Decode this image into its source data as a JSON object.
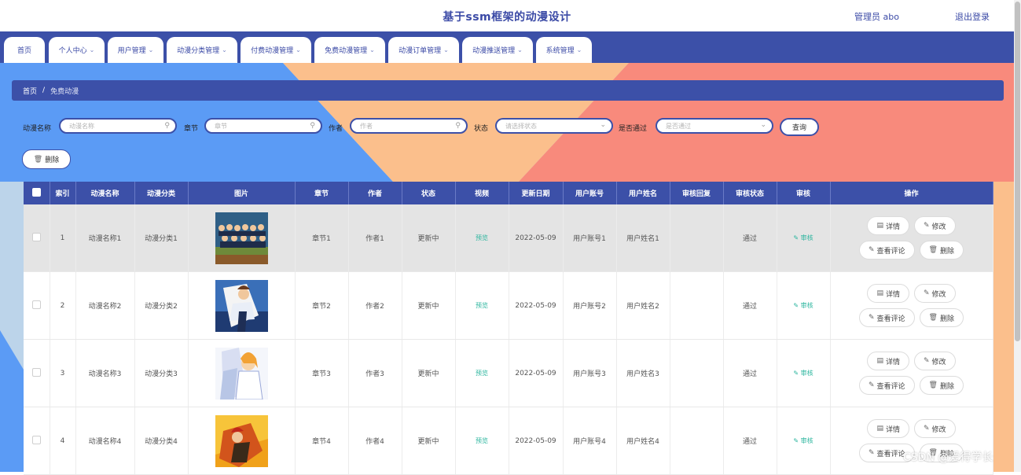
{
  "header": {
    "title": "基于ssm框架的动漫设计",
    "admin_label": "管理员 abo",
    "logout_label": "退出登录"
  },
  "nav": {
    "items": [
      {
        "label": "首页",
        "dropdown": false
      },
      {
        "label": "个人中心",
        "dropdown": true
      },
      {
        "label": "用户管理",
        "dropdown": true
      },
      {
        "label": "动漫分类管理",
        "dropdown": true
      },
      {
        "label": "付费动漫管理",
        "dropdown": true
      },
      {
        "label": "免费动漫管理",
        "dropdown": true
      },
      {
        "label": "动漫订单管理",
        "dropdown": true
      },
      {
        "label": "动漫推送管理",
        "dropdown": true
      },
      {
        "label": "系统管理",
        "dropdown": true
      }
    ]
  },
  "breadcrumb": {
    "home": "首页",
    "separator": "/",
    "current": "免费动漫"
  },
  "search": {
    "name_label": "动漫名称",
    "name_placeholder": "动漫名称",
    "chapter_label": "章节",
    "chapter_placeholder": "章节",
    "author_label": "作者",
    "author_placeholder": "作者",
    "status_label": "状态",
    "status_placeholder": "请选择状态",
    "approved_label": "是否通过",
    "approved_placeholder": "是否通过",
    "query_label": "查询"
  },
  "toolbar": {
    "delete_label": "删除"
  },
  "table": {
    "headers": [
      "索引",
      "动漫名称",
      "动漫分类",
      "图片",
      "章节",
      "作者",
      "状态",
      "视频",
      "更新日期",
      "用户账号",
      "用户姓名",
      "审核回复",
      "审核状态",
      "审核",
      "操作"
    ],
    "rows": [
      {
        "index": "1",
        "name": "动漫名称1",
        "category": "动漫分类1",
        "chapter": "章节1",
        "author": "作者1",
        "status": "更新中",
        "video": "预览",
        "date": "2022-05-09",
        "account": "用户账号1",
        "username": "用户姓名1",
        "reply": "",
        "review_status": "通过",
        "review": "审核"
      },
      {
        "index": "2",
        "name": "动漫名称2",
        "category": "动漫分类2",
        "chapter": "章节2",
        "author": "作者2",
        "status": "更新中",
        "video": "预览",
        "date": "2022-05-09",
        "account": "用户账号2",
        "username": "用户姓名2",
        "reply": "",
        "review_status": "通过",
        "review": "审核"
      },
      {
        "index": "3",
        "name": "动漫名称3",
        "category": "动漫分类3",
        "chapter": "章节3",
        "author": "作者3",
        "status": "更新中",
        "video": "预览",
        "date": "2022-05-09",
        "account": "用户账号3",
        "username": "用户姓名3",
        "reply": "",
        "review_status": "通过",
        "review": "审核"
      },
      {
        "index": "4",
        "name": "动漫名称4",
        "category": "动漫分类4",
        "chapter": "章节4",
        "author": "作者4",
        "status": "更新中",
        "video": "预览",
        "date": "2022-05-09",
        "account": "用户账号4",
        "username": "用户姓名4",
        "reply": "",
        "review_status": "通过",
        "review": "审核"
      }
    ],
    "ops": {
      "detail": "详情",
      "edit": "修改",
      "comments": "查看评论",
      "delete": "删除"
    }
  },
  "watermark": "CSDN @爱得学长",
  "colors": {
    "primary": "#3c50a8",
    "accent_blue": "#5b9bf5",
    "accent_orange": "#fbbf8c",
    "accent_red": "#f88a7c",
    "link_green": "#2bb59e"
  },
  "icons": {
    "search": "search-icon",
    "chevron": "chevron-down-icon",
    "delete": "trash-icon",
    "detail": "document-icon",
    "edit": "pencil-icon"
  }
}
